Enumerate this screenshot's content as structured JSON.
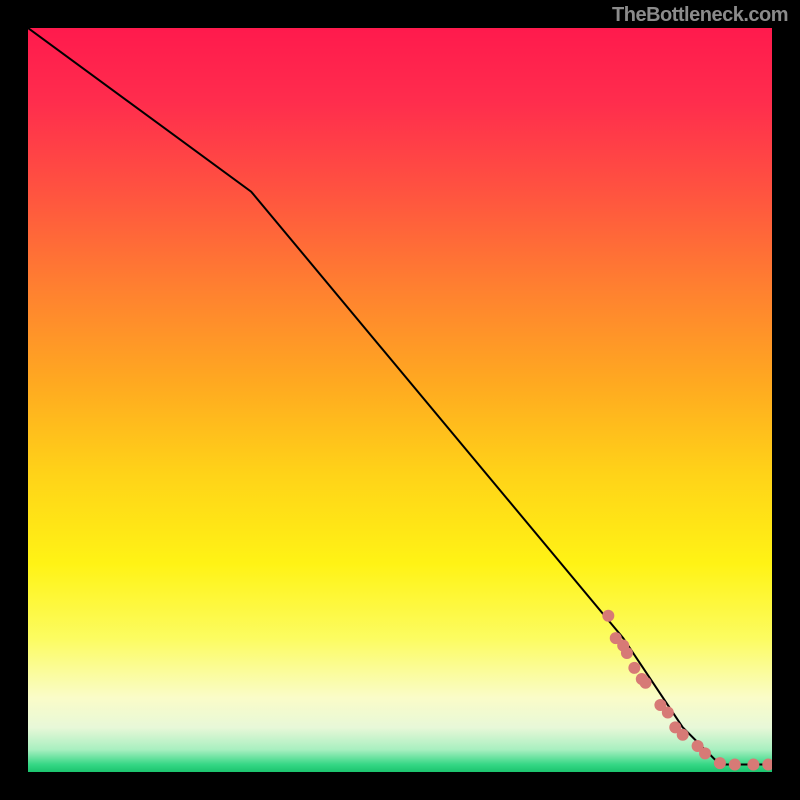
{
  "attribution": "TheBottleneck.com",
  "colors": {
    "marker": "#d77a76",
    "line": "#000000"
  },
  "chart_data": {
    "type": "line",
    "title": "",
    "xlabel": "",
    "ylabel": "",
    "xlim": [
      0,
      100
    ],
    "ylim": [
      0,
      100
    ],
    "curve": [
      {
        "x": 0,
        "y": 100
      },
      {
        "x": 30,
        "y": 78
      },
      {
        "x": 80,
        "y": 18
      },
      {
        "x": 88,
        "y": 6
      },
      {
        "x": 93,
        "y": 1
      },
      {
        "x": 100,
        "y": 1
      }
    ],
    "markers": [
      {
        "x": 78,
        "y": 21
      },
      {
        "x": 79,
        "y": 18
      },
      {
        "x": 80,
        "y": 17
      },
      {
        "x": 80.5,
        "y": 16
      },
      {
        "x": 81.5,
        "y": 14
      },
      {
        "x": 82.5,
        "y": 12.5
      },
      {
        "x": 83,
        "y": 12
      },
      {
        "x": 85,
        "y": 9
      },
      {
        "x": 86,
        "y": 8
      },
      {
        "x": 87,
        "y": 6
      },
      {
        "x": 88,
        "y": 5
      },
      {
        "x": 90,
        "y": 3.5
      },
      {
        "x": 91,
        "y": 2.5
      },
      {
        "x": 93,
        "y": 1.2
      },
      {
        "x": 95,
        "y": 1
      },
      {
        "x": 97.5,
        "y": 1
      },
      {
        "x": 99.5,
        "y": 1
      }
    ],
    "marker_radius_px": 6
  }
}
